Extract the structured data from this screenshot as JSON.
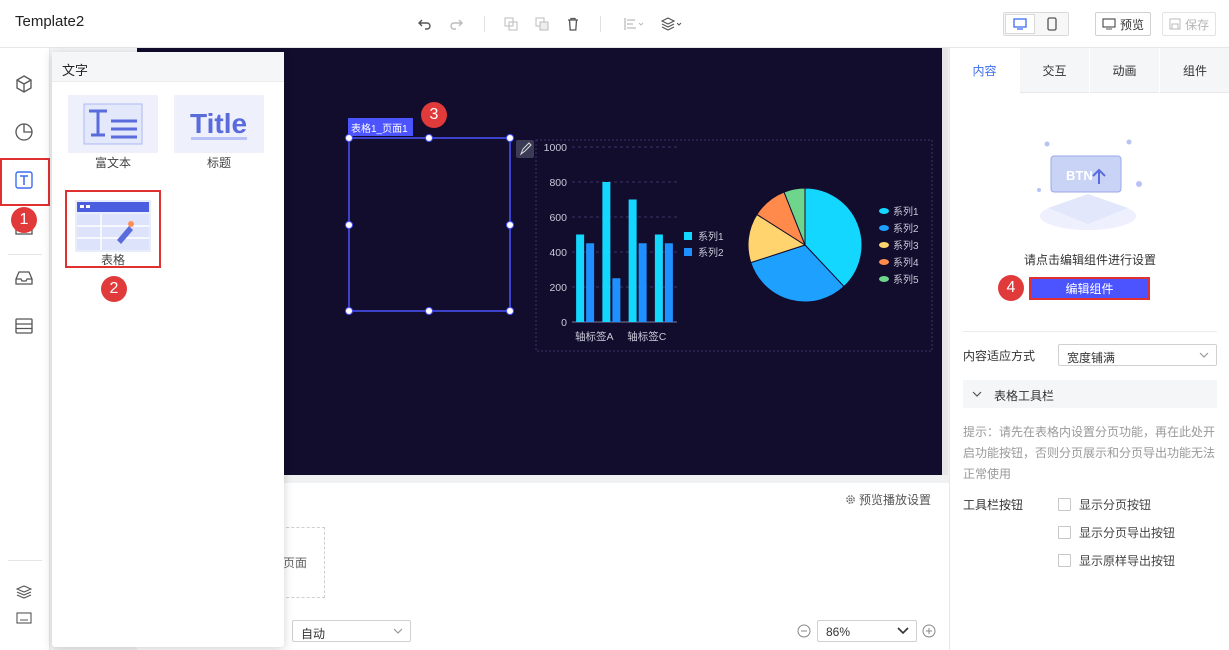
{
  "app": {
    "title": "Template2"
  },
  "toolbar": {
    "undo_icon": "undo-icon",
    "redo_icon": "redo-icon",
    "preview_label": "预览",
    "save_label": "保存"
  },
  "component_panel": {
    "title": "文字",
    "items": [
      {
        "label": "富文本",
        "icon": "rich-text-icon"
      },
      {
        "label": "标题",
        "icon": "title-icon",
        "icon_text": "Title"
      },
      {
        "label": "表格",
        "icon": "table-icon"
      }
    ]
  },
  "canvas": {
    "table_widget_label": "表格1_页面1"
  },
  "chart_data": [
    {
      "type": "bar",
      "categories": [
        "轴标签A",
        "",
        "轴标签C",
        ""
      ],
      "xlabels_shown": [
        "轴标签A",
        "轴标签C"
      ],
      "ylim": [
        0,
        1000
      ],
      "yticks": [
        0,
        200,
        400,
        600,
        800,
        1000
      ],
      "series": [
        {
          "name": "系列1",
          "color": "#14d7ff",
          "values": [
            500,
            800,
            700,
            500
          ]
        },
        {
          "name": "系列2",
          "color": "#1e90ff",
          "values": [
            450,
            250,
            450,
            450
          ]
        }
      ]
    },
    {
      "type": "pie",
      "slices": [
        {
          "name": "系列1",
          "value": 38,
          "color": "#14d7ff"
        },
        {
          "name": "系列2",
          "value": 32,
          "color": "#1ea0ff"
        },
        {
          "name": "系列3",
          "value": 14,
          "color": "#ffd46e"
        },
        {
          "name": "系列4",
          "value": 10,
          "color": "#ff8a4c"
        },
        {
          "name": "系列5",
          "value": 6,
          "color": "#6dd58c"
        }
      ]
    }
  ],
  "bottom": {
    "preview_settings": "预览播放设置",
    "page_label": "页面",
    "zoom_mode": "自动",
    "zoom_value": "86%"
  },
  "right_panel": {
    "tabs": [
      "内容",
      "交互",
      "动画",
      "组件"
    ],
    "active_tab": "内容",
    "edit_hint": "请点击编辑组件进行设置",
    "edit_button": "编辑组件",
    "fit_label": "内容适应方式",
    "fit_value": "宽度铺满",
    "section_title": "表格工具栏",
    "tip": "提示：请先在表格内设置分页功能，再在此处开启功能按钮，否则分页展示和分页导出功能无法正常使用",
    "toolbar_buttons_label": "工具栏按钮",
    "checkboxes": [
      "显示分页按钮",
      "显示分页导出按钮",
      "显示原样导出按钮"
    ]
  },
  "annotations": [
    "1",
    "2",
    "3",
    "4"
  ],
  "colors": {
    "accent": "#4b54ff",
    "annotation_red": "#e03a3a",
    "canvas_bg": "#120c2d"
  }
}
